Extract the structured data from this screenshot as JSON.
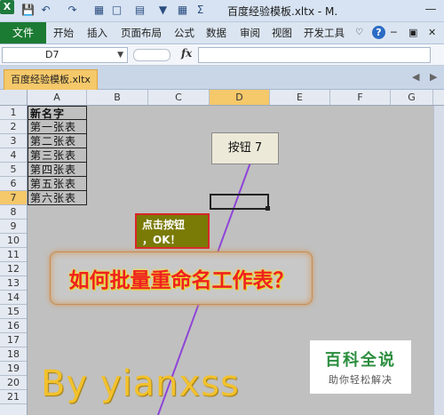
{
  "titlebar": {
    "app_icon": "X",
    "quick_access": [
      "save-icon",
      "undo-icon",
      "redo-icon",
      "print-preview-icon",
      "new-icon",
      "format-icon",
      "filter-icon",
      "border-icon",
      "sum-icon"
    ],
    "title": "百度经验模板.xltx - M.",
    "minimize": "—"
  },
  "ribbon": {
    "file_tab": "文件",
    "tabs": [
      "开始",
      "插入",
      "页面布局",
      "公式",
      "数据",
      "审阅",
      "视图",
      "开发工具"
    ]
  },
  "formula_bar": {
    "name_box": "D7",
    "fx": "fx",
    "formula": ""
  },
  "workbook_tab": "百度经验模板.xltx",
  "grid": {
    "columns": [
      "A",
      "B",
      "C",
      "D",
      "E",
      "F",
      "G"
    ],
    "active_column": "D",
    "rows": [
      "1",
      "2",
      "3",
      "4",
      "5",
      "6",
      "7",
      "8",
      "9",
      "10",
      "11",
      "12",
      "13",
      "14",
      "15",
      "16",
      "17",
      "18",
      "19",
      "20",
      "21"
    ],
    "active_row": "7",
    "column_a_header": "新名字",
    "column_a_values": [
      "第一张表",
      "第二张表",
      "第三张表",
      "第四张表",
      "第五张表",
      "第六张表"
    ]
  },
  "sheet_button_label": "按钮 7",
  "callout": {
    "line1": "点击按钮",
    "line2": "，OK！"
  },
  "banner_text": "如何批量重命名工作表？",
  "watermark": "By yianxss",
  "logo": {
    "title": "百科全说",
    "subtitle": "助你轻松解决"
  },
  "colors": {
    "file_tab": "#1c7b33",
    "active_header": "#f5c86a",
    "sheet_bg": "#c0c0c0",
    "callout_bg": "#7a7a06",
    "callout_border": "#d82626",
    "banner_text": "#ee2121",
    "line": "#8e44d8"
  }
}
